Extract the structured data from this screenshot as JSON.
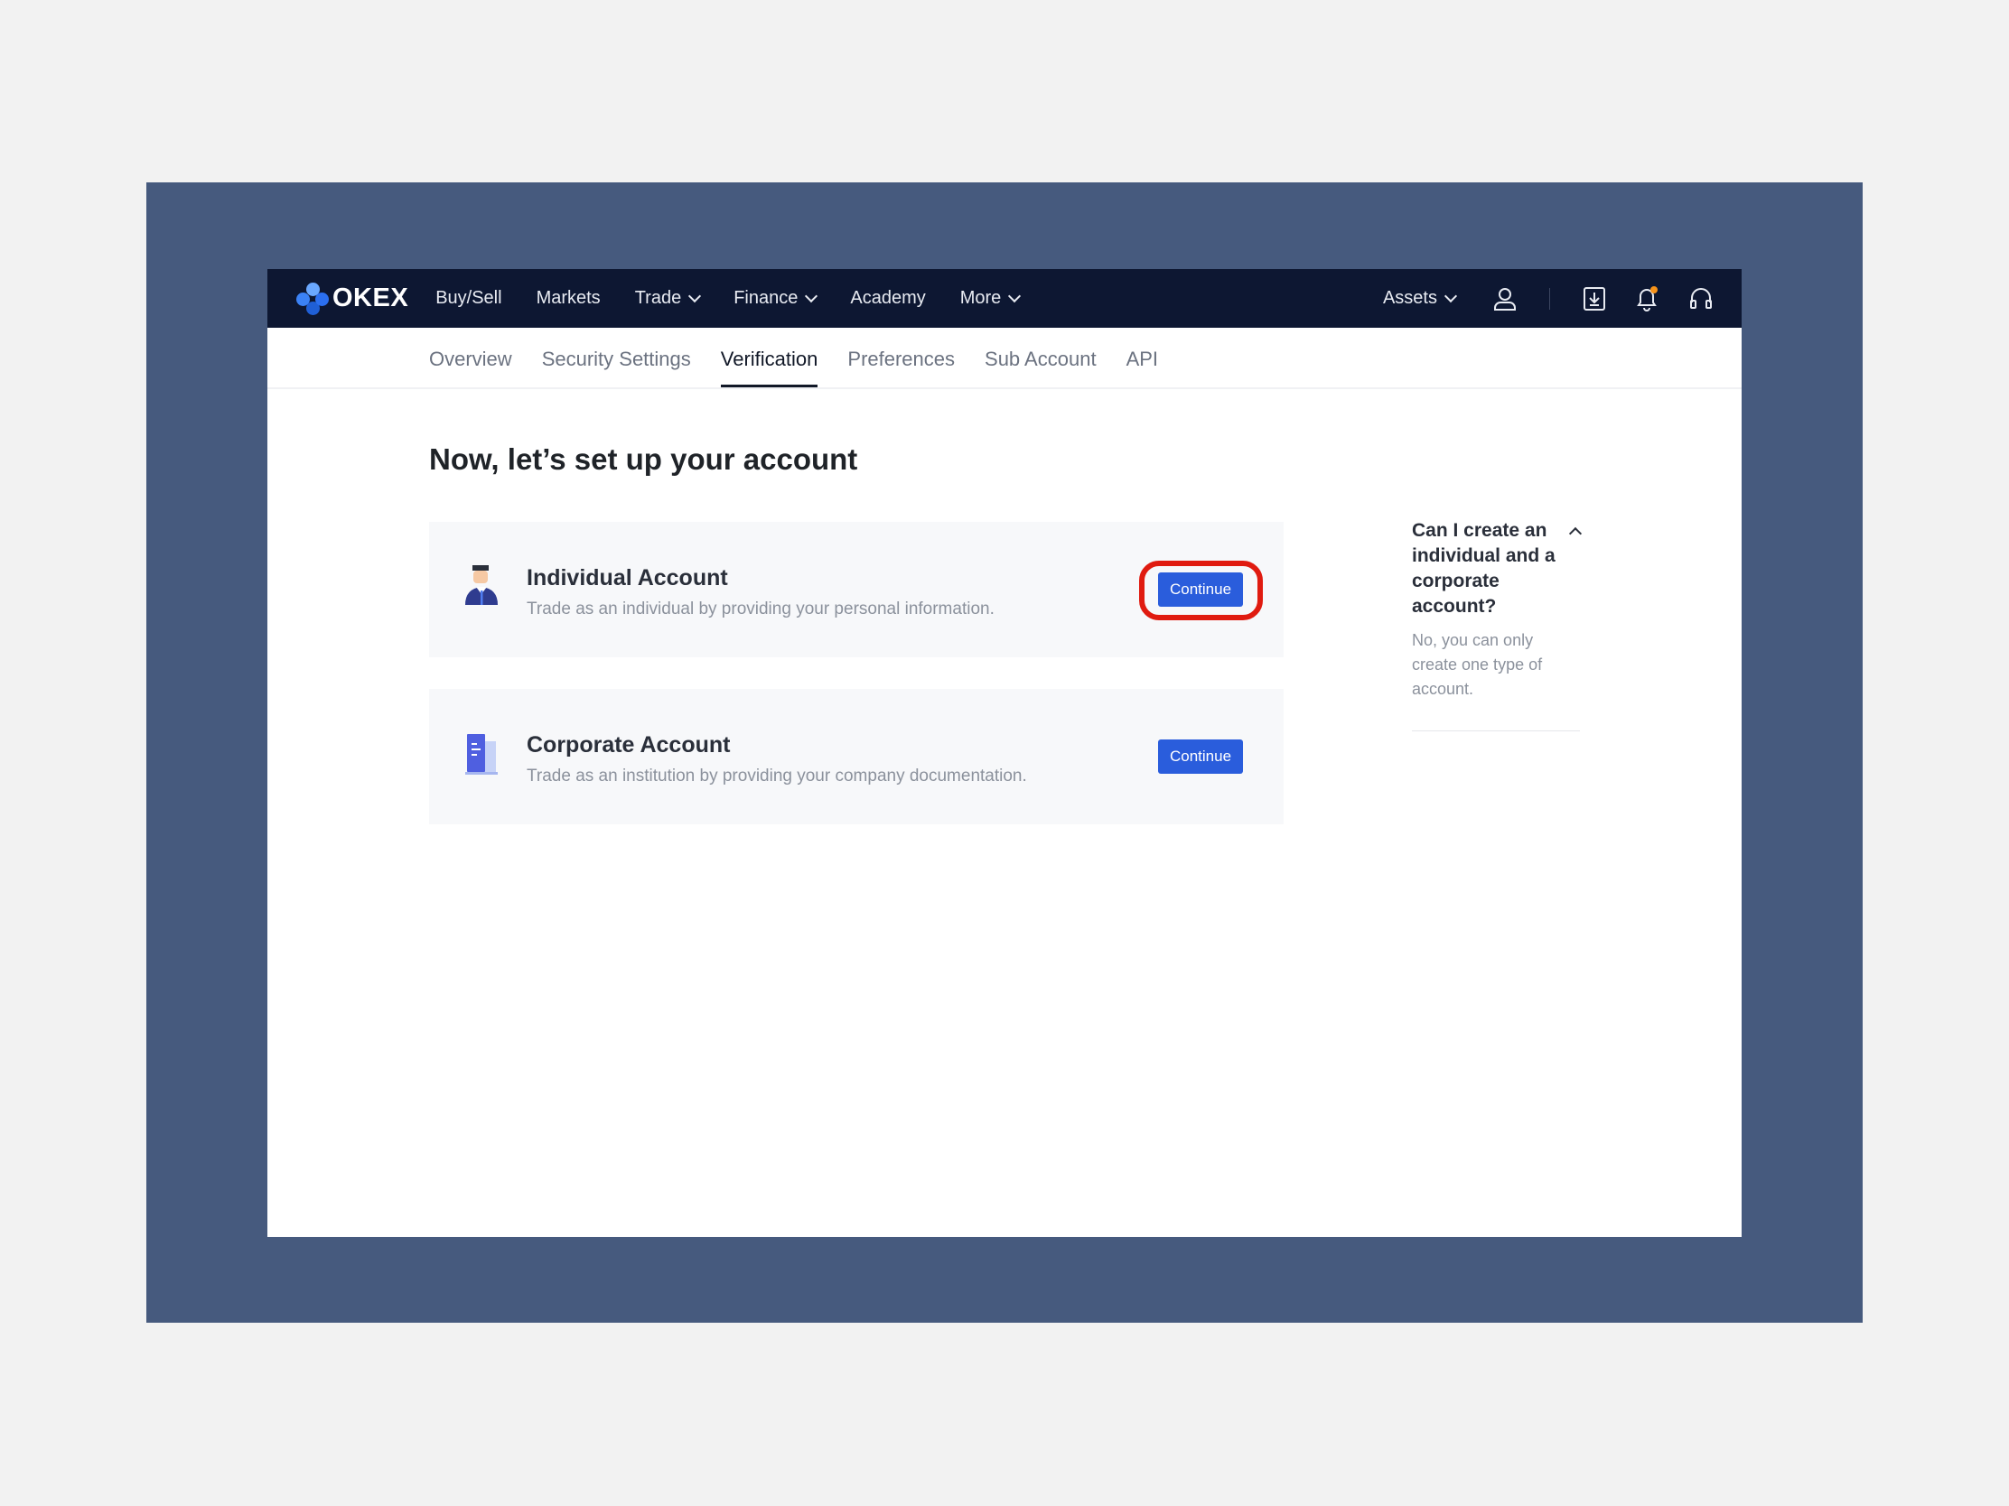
{
  "brand": {
    "name": "OKEX",
    "logo_colors": [
      "#3b82f6",
      "#1f5fd6",
      "#6aa8ff",
      "#2b6ff0"
    ]
  },
  "topnav": {
    "items": [
      {
        "label": "Buy/Sell",
        "dropdown": false
      },
      {
        "label": "Markets",
        "dropdown": false
      },
      {
        "label": "Trade",
        "dropdown": true
      },
      {
        "label": "Finance",
        "dropdown": true
      },
      {
        "label": "Academy",
        "dropdown": false
      },
      {
        "label": "More",
        "dropdown": true
      }
    ],
    "right": {
      "assets_label": "Assets",
      "icons": [
        "user-icon",
        "download-icon",
        "bell-icon",
        "headset-icon"
      ],
      "notification_dot_color": "#f7931a"
    }
  },
  "subtabs": {
    "items": [
      "Overview",
      "Security Settings",
      "Verification",
      "Preferences",
      "Sub Account",
      "API"
    ],
    "active": "Verification"
  },
  "page": {
    "title": "Now, let’s set up your account"
  },
  "cards": [
    {
      "title": "Individual Account",
      "description": "Trade as an individual by providing your personal information.",
      "button_label": "Continue",
      "icon": "person-icon",
      "highlighted": true
    },
    {
      "title": "Corporate Account",
      "description": "Trade as an institution by providing your company documentation.",
      "button_label": "Continue",
      "icon": "building-icon",
      "highlighted": false
    }
  ],
  "faq": {
    "question": "Can I create an individual and a corporate account?",
    "answer": "No, you can only create one type of account.",
    "expanded": true
  },
  "colors": {
    "nav_bg": "#0d1732",
    "accent": "#2a5ddc",
    "highlight": "#e01b10",
    "backdrop": "#465a7e"
  }
}
